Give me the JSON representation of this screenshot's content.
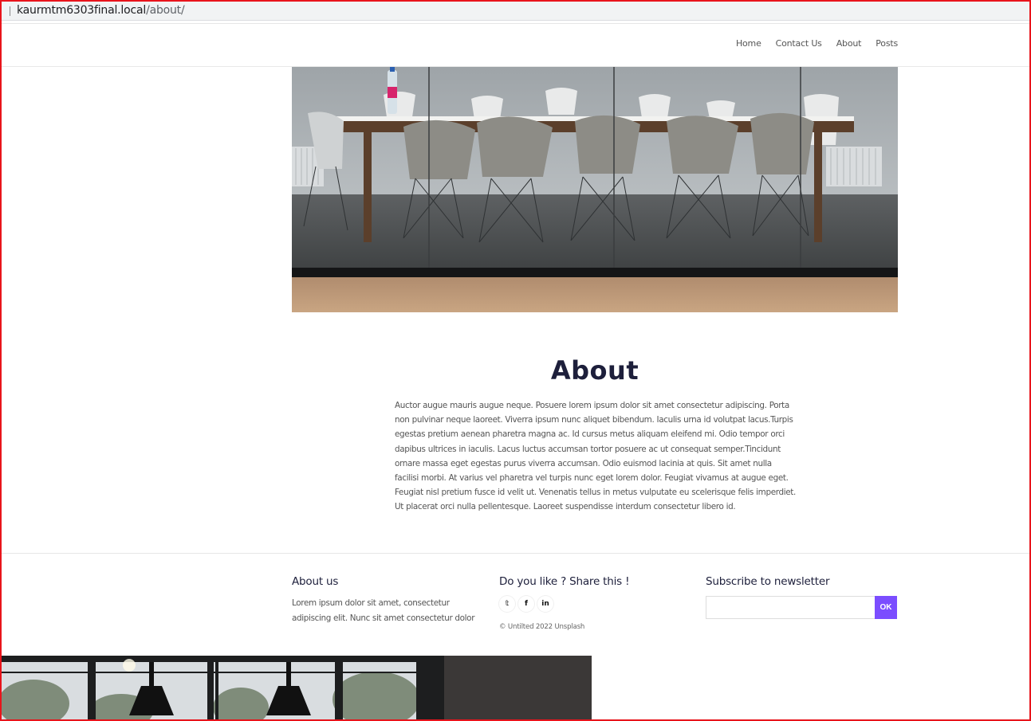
{
  "browser": {
    "url_host": "kaurmtm6303final.local",
    "url_path": "/about/"
  },
  "nav": {
    "items": [
      "Home",
      "Contact Us",
      "About",
      "Posts"
    ]
  },
  "about": {
    "title": "About",
    "body": "Auctor augue mauris augue neque. Posuere lorem ipsum dolor sit amet consectetur adipiscing. Porta non pulvinar neque laoreet. Viverra ipsum nunc aliquet bibendum. Iaculis urna id volutpat lacus.Turpis egestas pretium aenean pharetra magna ac. Id cursus metus aliquam eleifend mi. Odio tempor orci dapibus ultrices in iaculis. Lacus luctus accumsan tortor posuere ac ut consequat semper.Tincidunt ornare massa eget egestas purus viverra accumsan. Odio euismod lacinia at quis. Sit amet nulla facilisi morbi. At varius vel pharetra vel turpis nunc eget lorem dolor. Feugiat vivamus at augue eget. Feugiat nisl pretium fusce id velit ut. Venenatis tellus in metus vulputate eu scelerisque felis imperdiet. Ut placerat orci nulla pellentesque. Laoreet suspendisse interdum consectetur libero id."
  },
  "footer": {
    "about_heading": "About us",
    "about_text": "Lorem ipsum dolor sit amet, consectetur adipiscing elit. Nunc sit amet consectetur dolor",
    "share_heading": "Do you like ? Share this !",
    "social_icons": [
      "twitter-icon",
      "facebook-icon",
      "linkedin-icon"
    ],
    "social_glyphs": [
      "𝕥",
      "f",
      "in"
    ],
    "copyright": "© Untilted 2022 Unsplash",
    "newsletter_heading": "Subscribe to newsletter",
    "newsletter_placeholder": "",
    "newsletter_button": "OK"
  },
  "colors": {
    "accent": "#7b4dff",
    "title": "#1d1f3b",
    "frame": "#e8141b"
  }
}
